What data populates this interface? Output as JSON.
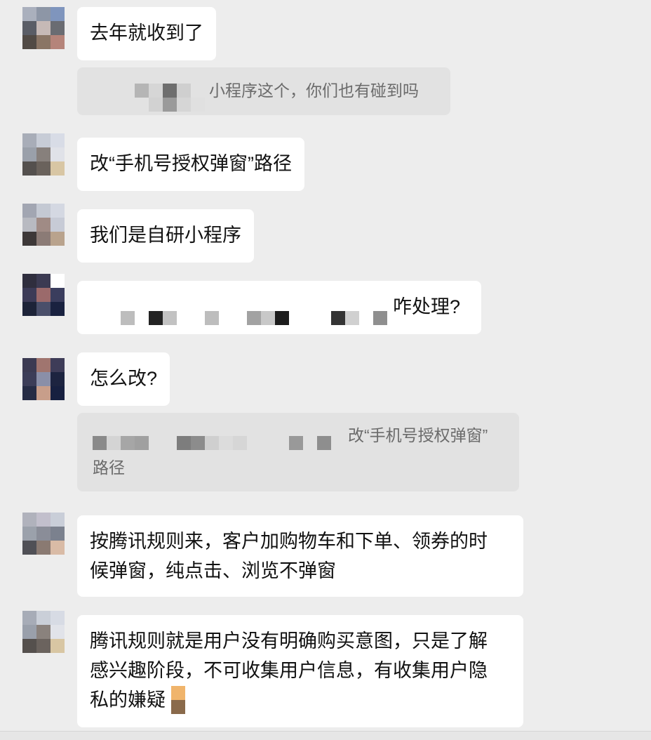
{
  "messages": [
    {
      "id": "m1",
      "text": "去年就收到了"
    },
    {
      "id": "q1",
      "quote_text": "小程序这个，你们也有碰到吗"
    },
    {
      "id": "m2",
      "text": "改“手机号授权弹窗”路径"
    },
    {
      "id": "m3",
      "text": "我们是自研小程序"
    },
    {
      "id": "m4",
      "text": "咋处理?"
    },
    {
      "id": "m5",
      "text": "怎么改?"
    },
    {
      "id": "q2",
      "quote_text_1": "改“手机号授权弹窗”",
      "quote_text_2": "路径"
    },
    {
      "id": "m6",
      "text_1": "按腾讯规则来，客户加购物车和下单、领券的时",
      "text_2": "候弹窗，纯点击、浏览不弹窗"
    },
    {
      "id": "m7",
      "text_1": "腾讯规则就是用户没有明确购买意图，只是了解",
      "text_2": "感兴趣阶段，不可收集用户信息，有收集用户隐",
      "text_3": "私的嫌疑"
    }
  ],
  "avatars": [
    {
      "name": "avatar-1",
      "colors": [
        "#aab0bd",
        "#8d96a6",
        "#7f95bd",
        "#5a5d66",
        "#c6b9b6",
        "#6a6c72",
        "#514a45",
        "#8a7565",
        "#b5847a"
      ]
    },
    {
      "name": "avatar-2",
      "colors": [
        "#a8adb8",
        "#c7ccd6",
        "#d8dce6",
        "#9aa0aa",
        "#87807c",
        "#e0e2e8",
        "#54504e",
        "#6a625c",
        "#d8c6a4"
      ]
    },
    {
      "name": "avatar-3",
      "colors": [
        "#a2a6b2",
        "#c4c9d3",
        "#d4d8e2",
        "#b8bac1",
        "#a08b85",
        "#c7cbd6",
        "#3d3838",
        "#8b7b76",
        "#b9a38d"
      ]
    },
    {
      "name": "avatar-4",
      "colors": [
        "#2f2e3e",
        "#3b3a52",
        "#ffffff",
        "#3c3b57",
        "#9b6a6b",
        "#3a3d5d",
        "#1d2338",
        "#4a4f6a",
        "#1a2240"
      ]
    },
    {
      "name": "avatar-5",
      "colors": [
        "#3b3a52",
        "#a0756f",
        "#3e3c58",
        "#3c3d58",
        "#8a8fa8",
        "#1d2440",
        "#262c45",
        "#c89e8a",
        "#172040"
      ]
    },
    {
      "name": "avatar-6",
      "colors": [
        "#b0b2bc",
        "#c2bfcc",
        "#c9ced8",
        "#9ba1ab",
        "#8a8d98",
        "#7b818e",
        "#505056",
        "#8a7a72",
        "#d9bba6"
      ]
    },
    {
      "name": "avatar-7",
      "colors": [
        "#a7acb7",
        "#cacfd8",
        "#d7dbe4",
        "#9aa0ab",
        "#8a827d",
        "#e1e3e9",
        "#55504d",
        "#6b635e",
        "#d8c6a3"
      ]
    }
  ]
}
